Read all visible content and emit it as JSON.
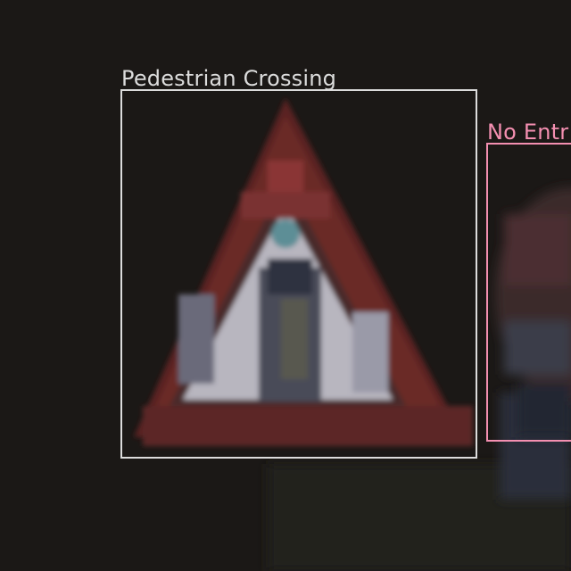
{
  "detections": [
    {
      "label": "Pedestrian Crossing",
      "color": "#dcdcdc"
    },
    {
      "label": "No Entr",
      "color": "#f48fb1"
    }
  ],
  "scene": {
    "background": "#1b1816",
    "sign_colors": {
      "frame": "#6a2a26",
      "white": "#c8c6cc",
      "figure": "#3a3c4a"
    }
  }
}
